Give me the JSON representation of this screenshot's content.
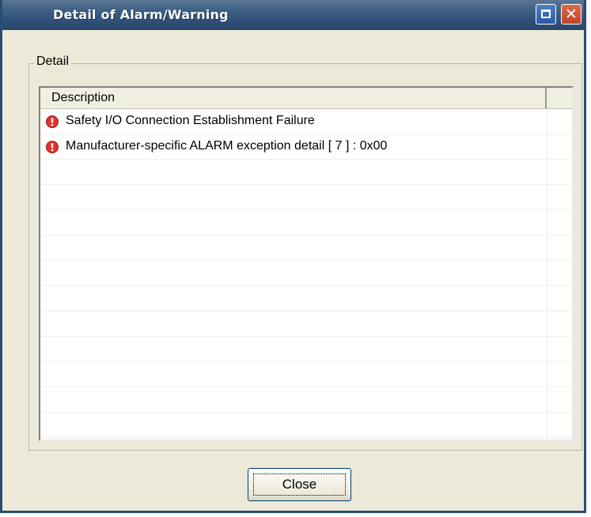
{
  "window": {
    "title": "Detail of Alarm/Warning"
  },
  "group": {
    "label": "Detail"
  },
  "list": {
    "columns": [
      "Description",
      ""
    ],
    "items": [
      {
        "icon": "alarm-icon",
        "text": "Safety I/O Connection Establishment Failure"
      },
      {
        "icon": "alarm-icon",
        "text": "Manufacturer-specific ALARM exception detail [ 7 ] : 0x00"
      }
    ],
    "empty_rows": 11
  },
  "buttons": {
    "close_label": "Close"
  },
  "colors": {
    "titlebar": "#2f5079",
    "alarm_icon": "#e0342b",
    "window_face": "#ece9d8"
  }
}
